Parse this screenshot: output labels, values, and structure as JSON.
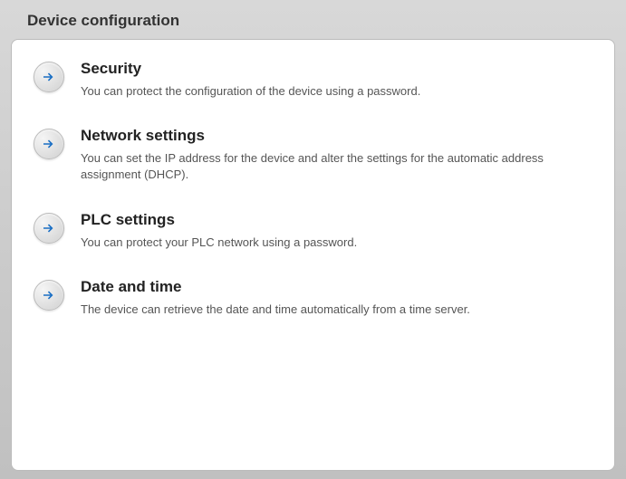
{
  "header": {
    "title": "Device configuration"
  },
  "items": [
    {
      "id": "security",
      "title": "Security",
      "description": "You can protect the configuration of the device using a password."
    },
    {
      "id": "network-settings",
      "title": "Network settings",
      "description": "You can set the IP address for the device and alter the settings for the automatic address assignment (DHCP)."
    },
    {
      "id": "plc-settings",
      "title": "PLC settings",
      "description": "You can protect your PLC network using a password."
    },
    {
      "id": "date-and-time",
      "title": "Date and time",
      "description": "The device can retrieve the date and time automatically from a time server."
    }
  ]
}
